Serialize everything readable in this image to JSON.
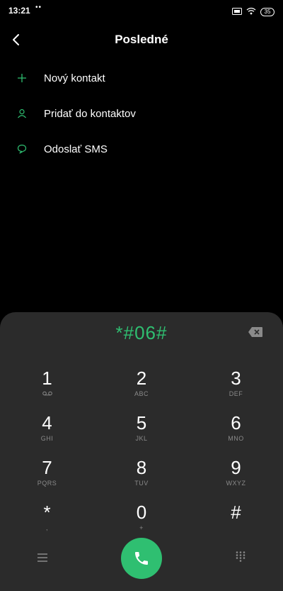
{
  "status_bar": {
    "time": "13:21",
    "dots": "••",
    "battery": "35"
  },
  "header": {
    "title": "Posledné"
  },
  "actions": [
    {
      "icon": "plus-icon",
      "label": "Nový kontakt"
    },
    {
      "icon": "person-icon",
      "label": "Pridať do kontaktov"
    },
    {
      "icon": "chat-bubble-icon",
      "label": "Odoslať SMS"
    }
  ],
  "dialpad": {
    "number": "*#06#",
    "keys": [
      {
        "digit": "1",
        "sub": ""
      },
      {
        "digit": "2",
        "sub": "ABC"
      },
      {
        "digit": "3",
        "sub": "DEF"
      },
      {
        "digit": "4",
        "sub": "GHI"
      },
      {
        "digit": "5",
        "sub": "JKL"
      },
      {
        "digit": "6",
        "sub": "MNO"
      },
      {
        "digit": "7",
        "sub": "PQRS"
      },
      {
        "digit": "8",
        "sub": "TUV"
      },
      {
        "digit": "9",
        "sub": "WXYZ"
      },
      {
        "digit": "*",
        "sub": ","
      },
      {
        "digit": "0",
        "sub": "+"
      },
      {
        "digit": "#",
        "sub": ""
      }
    ]
  },
  "colors": {
    "accent": "#2fbf71",
    "background": "#000000",
    "dialpad_bg": "#2b2b2b"
  }
}
